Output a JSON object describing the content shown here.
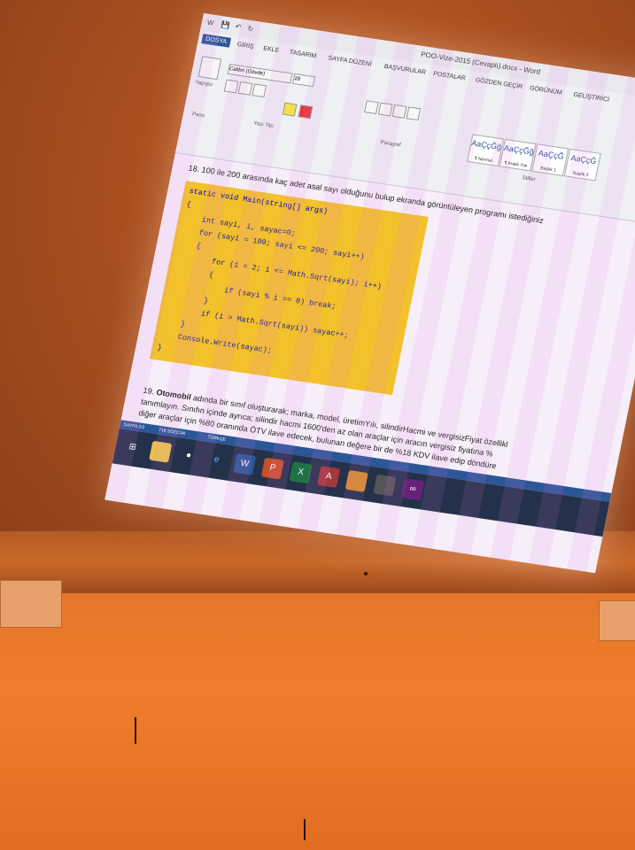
{
  "window": {
    "title": "POO-Vize-2015 (Cevaplı).docx - Word",
    "tabs": [
      "DOSYA",
      "GİRİŞ",
      "EKLE",
      "TASARIM",
      "SAYFA DÜZENİ",
      "BAŞVURULAR",
      "POSTALAR",
      "GÖZDEN GEÇİR",
      "GÖRÜNÜM",
      "GELİŞTİRİCİ"
    ],
    "active_tab": "DOSYA"
  },
  "ribbon": {
    "paste_label": "Yapıştır",
    "clipboard_group": "Pano",
    "font_name": "Calibri (Gövde)",
    "font_size": "18",
    "font_group": "Yazı Tipi",
    "paragraph_group": "Paragraf",
    "styles": [
      {
        "sample": "AaÇçĞğ",
        "name": "¶ Normal"
      },
      {
        "sample": "AaÇçĞğ",
        "name": "¶ Aralık Yok"
      },
      {
        "sample": "AaÇçĞ",
        "name": "Başlık 1"
      },
      {
        "sample": "AaÇçĞ",
        "name": "Başlık 2"
      }
    ],
    "styles_group": "Stiller"
  },
  "document": {
    "q18_text": "18. 100 ile 200 arasında kaç adet asal sayı olduğunu bulup ekranda görüntüleyen programı istediğiniz",
    "code_lines": [
      "static void Main(string[] args)",
      "{",
      "    int sayi, i, sayac=0;",
      "    for (sayi = 100; sayi <= 200; sayi++)",
      "    {",
      "        for (i = 2; i <= Math.Sqrt(sayi); i++)",
      "        {",
      "            if (sayi % i == 0) break;",
      "        }",
      "        if (i > Math.Sqrt(sayi)) sayac++;",
      "    }",
      "    Console.Write(sayac);",
      "}"
    ],
    "q19_num": "19.",
    "q19_bold": "Otomobil",
    "q19_text": "adında bir sınıf oluşturarak; marka, model, üretimYılı, silindirHacmi ve vergisizFiyat özellikl",
    "q19_line2": "tanımlayın. Sınıfın içinde ayrıca; silindir hacmi 1600'den az olan araçlar için aracın vergisiz fiyatına %",
    "q19_line3": "diğer araçlar için %80 oranında ÖTV ilave edecek, bulunan değere bir de %18 KDV ilave edip döndüre"
  },
  "statusbar": {
    "page": "SAYFA 2/2",
    "words": "718 SÖZCÜK",
    "language": "TÜRKÇE"
  },
  "taskbar": {
    "icons": [
      "windows-start",
      "file-explorer",
      "chrome",
      "internet-explorer",
      "word",
      "powerpoint",
      "excel",
      "access",
      "paint",
      "terminal",
      "visual-studio"
    ],
    "active": "word"
  }
}
